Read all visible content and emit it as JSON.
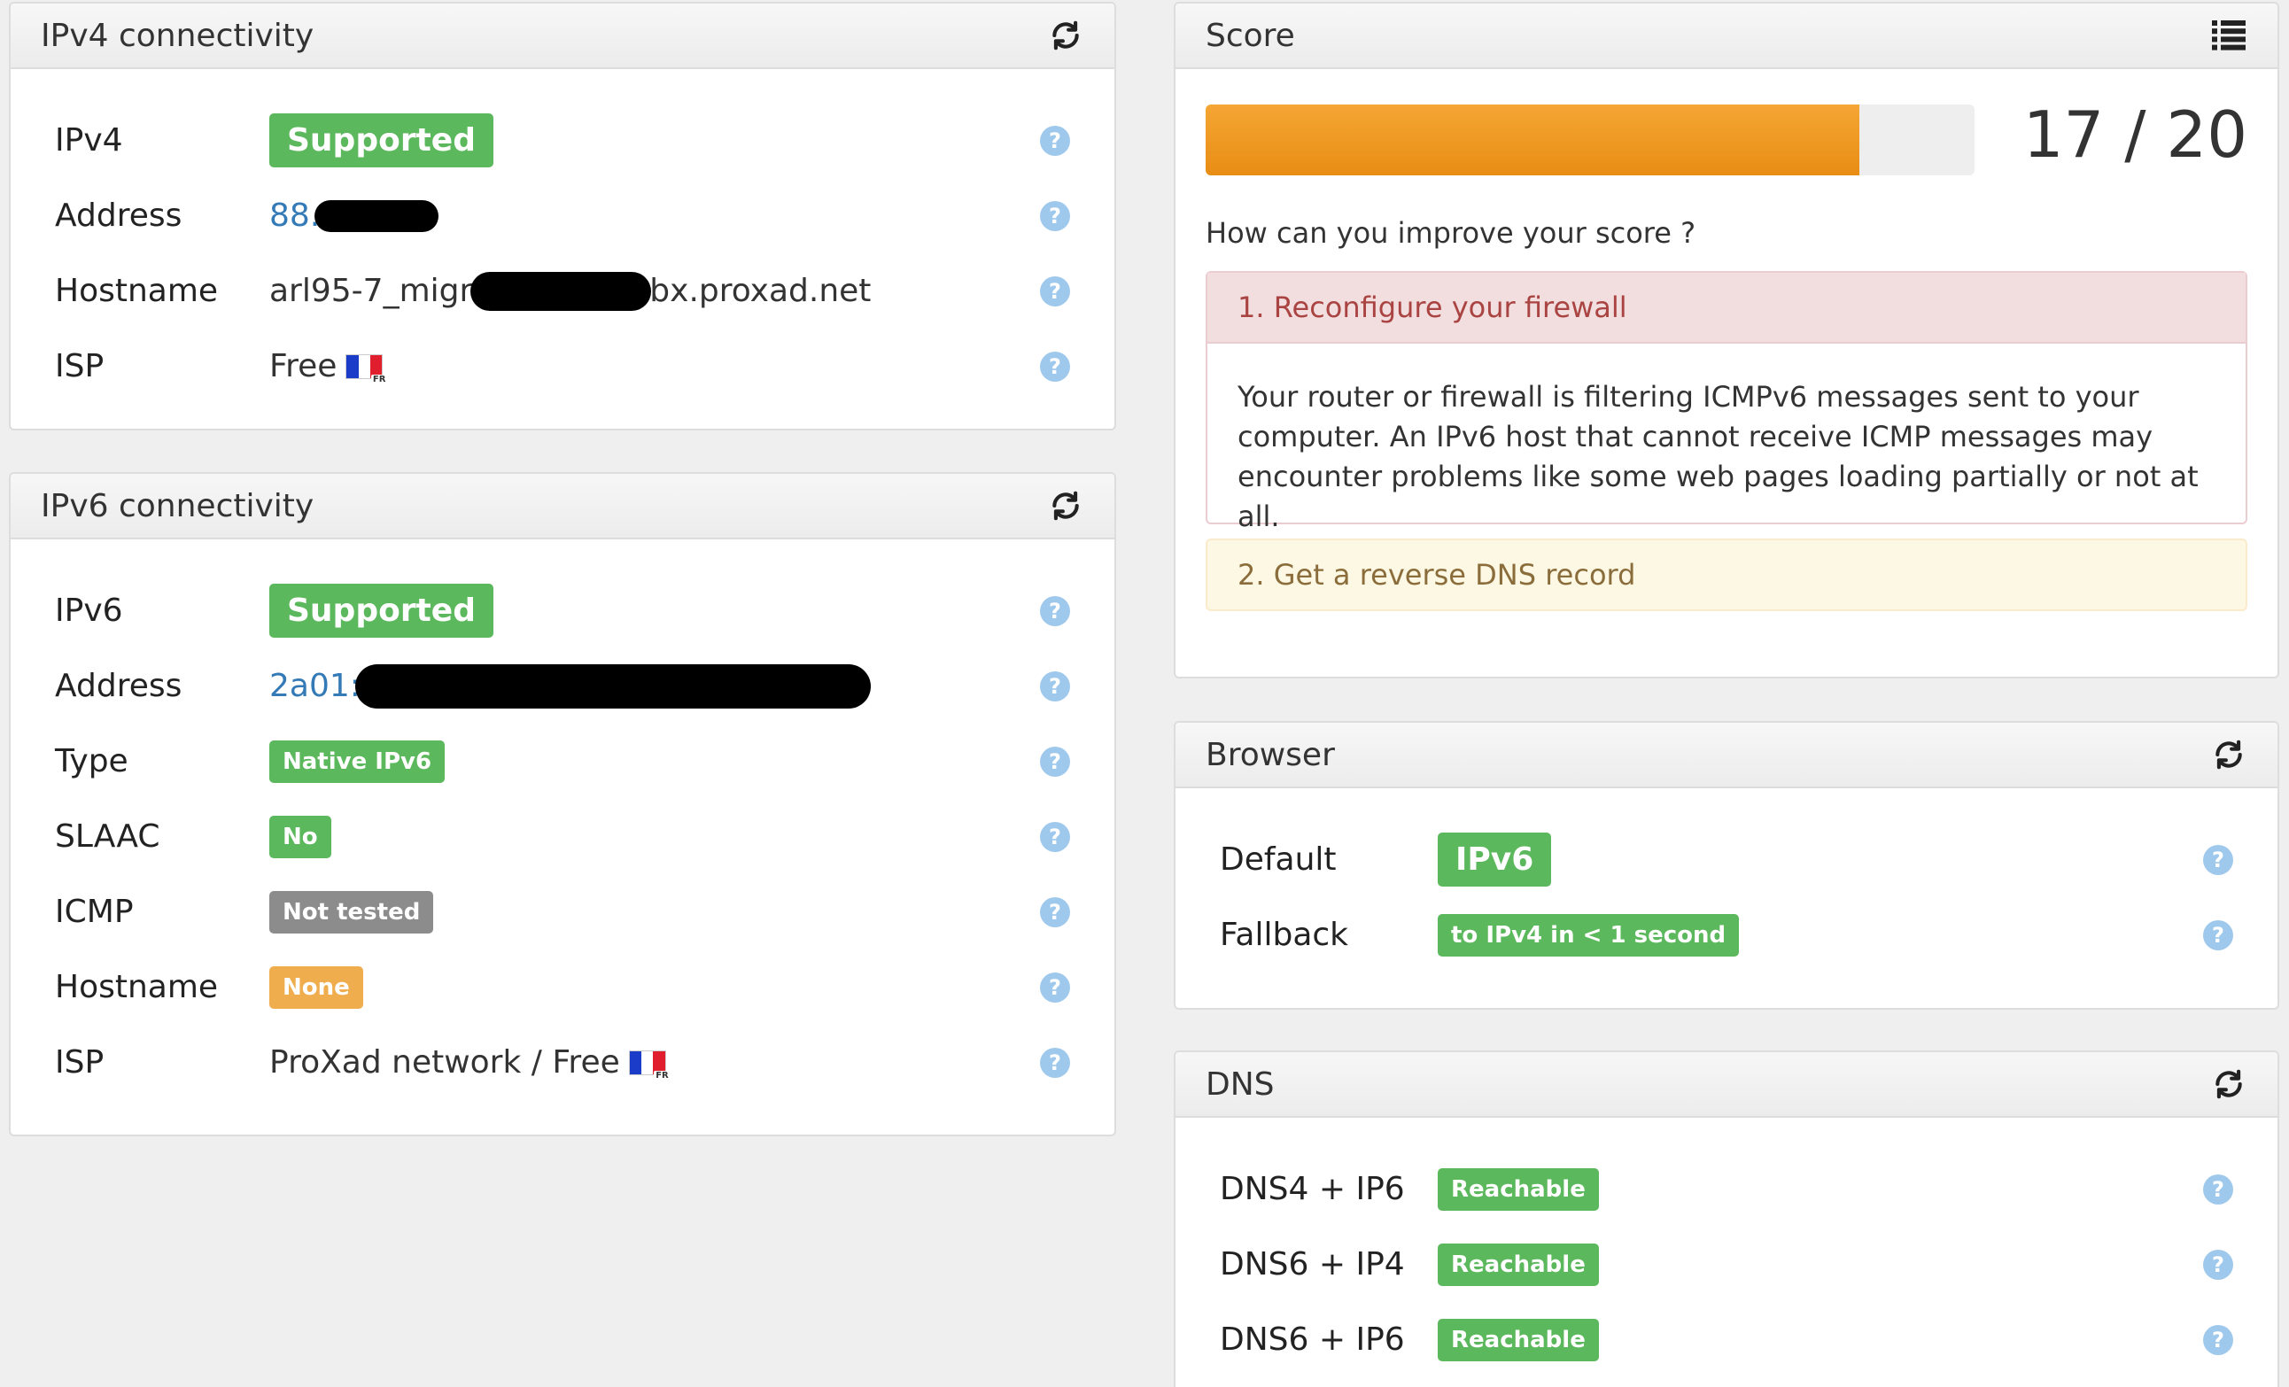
{
  "ipv4": {
    "title": "IPv4 connectivity",
    "rows": {
      "ipv4": {
        "label": "IPv4",
        "value": "Supported"
      },
      "address": {
        "label": "Address",
        "value": "88."
      },
      "hostname": {
        "label": "Hostname",
        "prefix": "arl95-7_migr",
        "suffix": "bx.proxad.net"
      },
      "isp": {
        "label": "ISP",
        "value": "Free",
        "flag_code": "FR"
      }
    }
  },
  "ipv6": {
    "title": "IPv6 connectivity",
    "rows": {
      "ipv6": {
        "label": "IPv6",
        "value": "Supported"
      },
      "address": {
        "label": "Address",
        "value": "2a01:"
      },
      "type": {
        "label": "Type",
        "value": "Native IPv6"
      },
      "slaac": {
        "label": "SLAAC",
        "value": "No"
      },
      "icmp": {
        "label": "ICMP",
        "value": "Not tested"
      },
      "hostname": {
        "label": "Hostname",
        "value": "None"
      },
      "isp": {
        "label": "ISP",
        "value": "ProXad network / Free",
        "flag_code": "FR"
      }
    }
  },
  "score": {
    "title": "Score",
    "value_text": "17 / 20",
    "progress_fraction": 0.85,
    "improve_question": "How can you improve your score ?",
    "tip1_title": "1. Reconfigure your firewall",
    "tip1_body": "Your router or firewall is filtering ICMPv6 messages sent to your computer. An IPv6 host that cannot receive ICMP messages may encounter problems like some web pages loading partially or not at all.",
    "tip2_title": "2. Get a reverse DNS record"
  },
  "browser": {
    "title": "Browser",
    "rows": {
      "default": {
        "label": "Default",
        "value": "IPv6"
      },
      "fallback": {
        "label": "Fallback",
        "value": "to IPv4 in < 1 second"
      }
    }
  },
  "dns": {
    "title": "DNS",
    "rows": {
      "dns4_ip6": {
        "label": "DNS4 + IP6",
        "value": "Reachable"
      },
      "dns6_ip4": {
        "label": "DNS6 + IP4",
        "value": "Reachable"
      },
      "dns6_ip6": {
        "label": "DNS6 + IP6",
        "value": "Reachable"
      }
    }
  },
  "icons": {
    "refresh": "refresh-icon",
    "list": "list-icon",
    "help": "help-icon",
    "flag": "france-flag-icon"
  },
  "colors": {
    "success": "#5cb85c",
    "warning": "#f0ad4e",
    "muted": "#8c8c8c",
    "link": "#337ab7",
    "progress": "#ec9a26",
    "danger_bg": "#f2dede",
    "warning_bg": "#fcf8e3"
  }
}
